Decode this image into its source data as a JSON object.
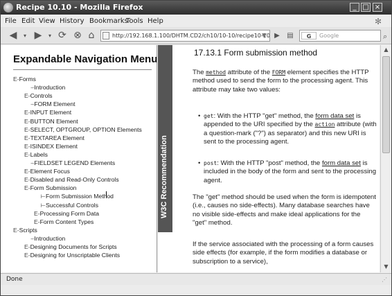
{
  "window": {
    "title": "Recipe 10.10 - Mozilla Firefox"
  },
  "menubar": {
    "items": [
      "File",
      "Edit",
      "View",
      "History",
      "Bookmarks",
      "Tools",
      "Help"
    ]
  },
  "navbar": {
    "url": "http://192.168.1.100/DHTM.CD2/ch10/10-10/recipe10-10.html",
    "search_engine": "G",
    "search_placeholder": "Google"
  },
  "nav": {
    "heading": "Expandable Navigation Menu",
    "tree": [
      {
        "prefix": "E-",
        "label": "Forms",
        "indent": 0
      },
      {
        "prefix": "",
        "label": "Introduction",
        "indent": 1
      },
      {
        "prefix": "E-",
        "label": "Controls",
        "indent": 1
      },
      {
        "prefix": "",
        "label": "FORM Element",
        "indent": 1
      },
      {
        "prefix": "E-",
        "label": "INPUT Element",
        "indent": 1
      },
      {
        "prefix": "E-",
        "label": "BUTTON Element",
        "indent": 1
      },
      {
        "prefix": "E-",
        "label": "SELECT, OPTGROUP, OPTION Elements",
        "indent": 1
      },
      {
        "prefix": "E-",
        "label": "TEXTAREA Element",
        "indent": 1
      },
      {
        "prefix": "E-",
        "label": "ISINDEX Element",
        "indent": 1
      },
      {
        "prefix": "E-",
        "label": "Labels",
        "indent": 1
      },
      {
        "prefix": "",
        "label": "FIELDSET LEGEND Elements",
        "indent": 1
      },
      {
        "prefix": "E-",
        "label": "Element Focus",
        "indent": 1
      },
      {
        "prefix": "E-",
        "label": "Disabled and Read-Only Controls",
        "indent": 1
      },
      {
        "prefix": "E-",
        "label": "Form Submission",
        "indent": 1
      },
      {
        "prefix": "",
        "label": "Form Submission Method",
        "indent": 2
      },
      {
        "prefix": "",
        "label": "Successful Controls",
        "indent": 2
      },
      {
        "prefix": "E-",
        "label": "Processing Form Data",
        "indent": 2
      },
      {
        "prefix": "E-",
        "label": "Form Content Types",
        "indent": 2
      },
      {
        "prefix": "E-",
        "label": "Scripts",
        "indent": 0
      },
      {
        "prefix": "",
        "label": "Introduction",
        "indent": 1
      },
      {
        "prefix": "E-",
        "label": "Designing Documents for Scripts",
        "indent": 1
      },
      {
        "prefix": "E-",
        "label": "Designing for Unscriptable Clients",
        "indent": 1
      }
    ]
  },
  "content": {
    "sidebar_label": "W3C Recommendation",
    "section_title": "17.13.1 Form submission method",
    "p1_a": "The ",
    "p1_code1": "method",
    "p1_b": " attribute of the ",
    "p1_code2": "FORM",
    "p1_c": " element specifies the HTTP method used to send the form to the processing agent. This attribute may take two values:",
    "b1_code": "get",
    "b1_a": ": With the HTTP \"get\" method, the ",
    "b1_link": "form data set",
    "b1_b": " is appended to the URI specified by the ",
    "b1_code2": "action",
    "b1_c": " attribute (with a question-mark (\"?\") as separator) and this new URI is sent to the processing agent.",
    "b2_code": "post",
    "b2_a": ": With the HTTP \"post\" method, the ",
    "b2_link": "form data set",
    "b2_b": " is included in the body of the form and sent to the processing agent.",
    "p2": "The \"get\" method should be used when the form is idempotent (i.e., causes no side-effects). Many database searches have no visible side-effects and make ideal applications for the \"get\" method.",
    "p3": "If the service associated with the processing of a form causes side effects (for example, if the form modifies a database or subscription to a service),"
  },
  "status": {
    "text": "Done"
  }
}
